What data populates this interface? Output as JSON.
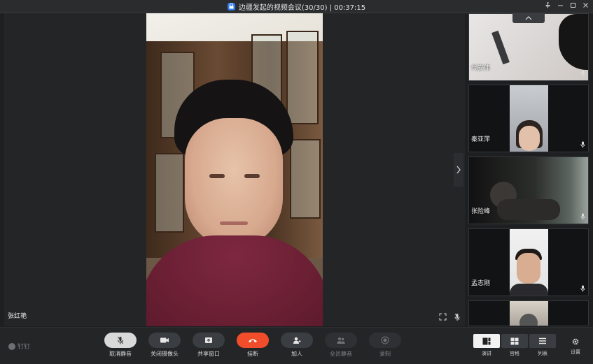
{
  "window": {
    "title": "边疆发起的视频会议(30/30) | 00:37:15",
    "controls": [
      "pin",
      "minimize",
      "maximize",
      "close"
    ]
  },
  "main": {
    "speaker_name": "张红艳"
  },
  "participants": [
    {
      "name": "代安伟"
    },
    {
      "name": "秦亚萍"
    },
    {
      "name": "张险峰"
    },
    {
      "name": "孟志刚"
    },
    {
      "name": ""
    }
  ],
  "toolbar": {
    "brand": "钉钉",
    "buttons": [
      {
        "label": "取消静音",
        "icon": "mic-muted-icon"
      },
      {
        "label": "关闭摄像头",
        "icon": "camera-icon"
      },
      {
        "label": "共享窗口",
        "icon": "share-screen-icon"
      },
      {
        "label": "挂断",
        "icon": "hang-up-icon"
      },
      {
        "label": "加人",
        "icon": "add-person-icon"
      },
      {
        "label": "全员静音",
        "icon": "mute-all-icon"
      },
      {
        "label": "录制",
        "icon": "record-icon"
      }
    ],
    "views": [
      {
        "label": "演讲",
        "icon": "speaker-view-icon"
      },
      {
        "label": "宫格",
        "icon": "grid-view-icon"
      },
      {
        "label": "列表",
        "icon": "list-view-icon"
      }
    ],
    "settings_label": "设置"
  },
  "colors": {
    "accent": "#2f7cf6",
    "hangup": "#f24d2b",
    "background": "#1d1f21"
  }
}
